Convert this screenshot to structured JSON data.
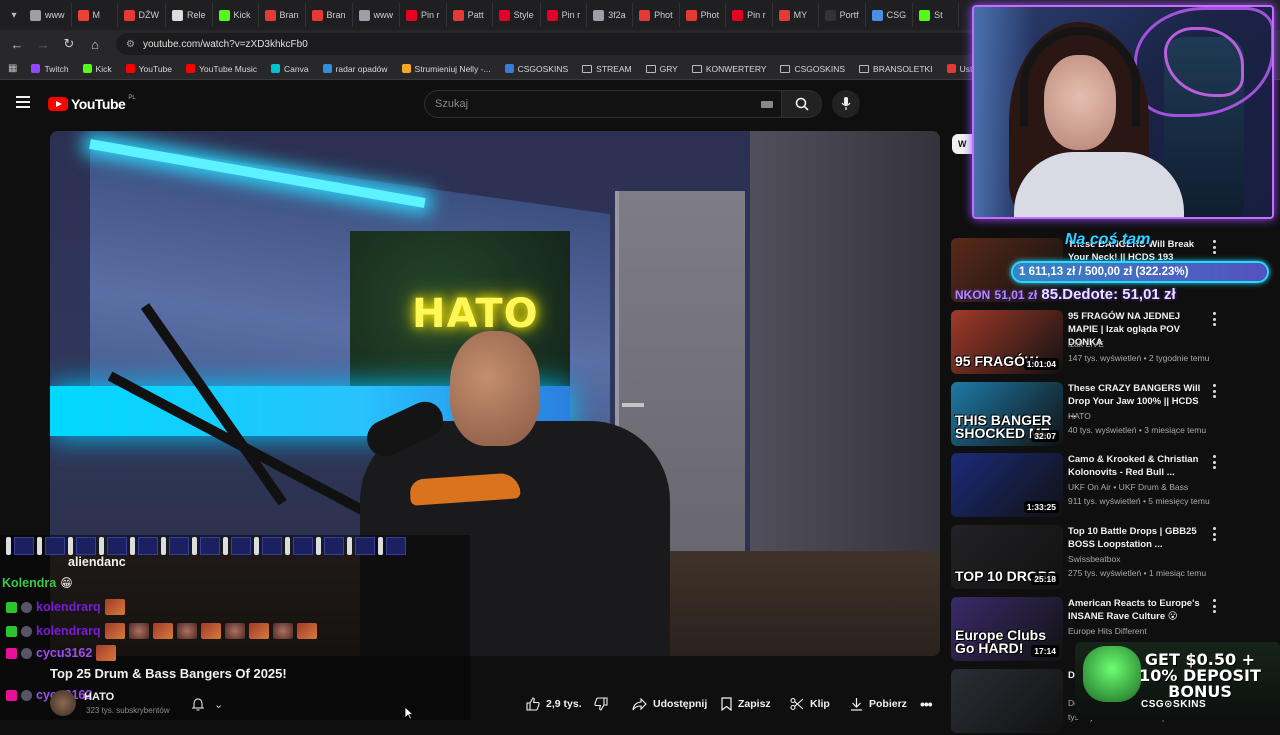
{
  "browser": {
    "tabs": [
      {
        "label": "www",
        "color": "#9aa0a6"
      },
      {
        "label": "M",
        "color": "#ea4335"
      },
      {
        "label": "DŹW",
        "color": "#e53935"
      },
      {
        "label": "Rele",
        "color": "#dddddd"
      },
      {
        "label": "Kick",
        "color": "#53fc18"
      },
      {
        "label": "Bran",
        "color": "#e53935"
      },
      {
        "label": "Bran",
        "color": "#e53935"
      },
      {
        "label": "www",
        "color": "#9aa0a6"
      },
      {
        "label": "Pin r",
        "color": "#e60023"
      },
      {
        "label": "Patt",
        "color": "#e53935"
      },
      {
        "label": "Style",
        "color": "#e60023"
      },
      {
        "label": "Pin r",
        "color": "#e60023"
      },
      {
        "label": "3f2a",
        "color": "#9aa0a6"
      },
      {
        "label": "Phot",
        "color": "#e53935"
      },
      {
        "label": "Phot",
        "color": "#e53935"
      },
      {
        "label": "Pin r",
        "color": "#e60023"
      },
      {
        "label": "MY",
        "color": "#e53935"
      },
      {
        "label": "Portf",
        "color": "#333333"
      },
      {
        "label": "CSG",
        "color": "#4a90e2"
      },
      {
        "label": "St",
        "color": "#53fc18"
      }
    ],
    "url": "youtube.com/watch?v=zXD3khkcFb0",
    "bookmarks": [
      {
        "label": "Twitch",
        "kind": "site",
        "color": "#9146ff"
      },
      {
        "label": "Kick",
        "kind": "site",
        "color": "#53fc18"
      },
      {
        "label": "YouTube",
        "kind": "site",
        "color": "#ff0000"
      },
      {
        "label": "YouTube Music",
        "kind": "site",
        "color": "#ff0000"
      },
      {
        "label": "Canva",
        "kind": "site",
        "color": "#00c4cc"
      },
      {
        "label": "radar opadów",
        "kind": "site",
        "color": "#2f8fd8"
      },
      {
        "label": "Strumieniuj Nelly -...",
        "kind": "site",
        "color": "#f5a623"
      },
      {
        "label": "CSGOSKINS",
        "kind": "site",
        "color": "#3a7bd5"
      },
      {
        "label": "STREAM",
        "kind": "folder"
      },
      {
        "label": "GRY",
        "kind": "folder"
      },
      {
        "label": "KONWERTERY",
        "kind": "folder"
      },
      {
        "label": "CSGOSKINS",
        "kind": "folder"
      },
      {
        "label": "BRANSOLETKI",
        "kind": "folder"
      },
      {
        "label": "Ustawienia strumien...",
        "kind": "site",
        "color": "#e53935"
      }
    ]
  },
  "youtube": {
    "logo": "YouTube",
    "region": "PL",
    "search_placeholder": "Szukaj",
    "chip_partial": "W"
  },
  "video": {
    "neon_sign": "HATO",
    "title": "Top 25 Drum & Bass Bangers Of 2025!",
    "channel": "HATO",
    "subscribers": "323 tys. subskrybentów",
    "likes": "2,9 tys.",
    "share_label": "Udostępnij",
    "save_label": "Zapisz",
    "clip_label": "Klip",
    "download_label": "Pobierz"
  },
  "chat": {
    "messages": [
      {
        "user": "aliendanc",
        "text": ""
      },
      {
        "user": "Kolendra",
        "text": ""
      },
      {
        "user": "kolendrarq",
        "text": ""
      },
      {
        "user": "kolendrarq",
        "text": ""
      },
      {
        "user": "cycu3162",
        "text": ""
      },
      {
        "user": "cycu3162",
        "text": ""
      }
    ]
  },
  "recommendations": [
    {
      "title": "These BANGERS Will Break Your Neck! || HCDS 193",
      "channel": "",
      "meta": "",
      "duration": "",
      "thumb": "#5a2a1a"
    },
    {
      "title": "95 FRAGÓW NA JEDNEJ MAPIE | Izak ogląda POV DONKA",
      "channel": "izak LIVE",
      "meta": "147 tys. wyświetleń • 2 tygodnie temu",
      "duration": "1:01:04",
      "thumb": "#a23a2a",
      "overlay": "95 FRAGÓW"
    },
    {
      "title": "These CRAZY BANGERS Will Drop Your Jaw 100% || HCDS ...",
      "channel": "HATO",
      "meta": "40 tys. wyświetleń • 3 miesiące temu",
      "duration": "32:07",
      "thumb": "#1e7aa8",
      "overlay": "THIS BANGER SHOCKED ME"
    },
    {
      "title": "Camo & Krooked & Christian Kolonovits - Red Bull ...",
      "channel": "UKF On Air • UKF Drum & Bass",
      "meta": "911 tys. wyświetleń • 5 miesięcy temu",
      "duration": "1:33:25",
      "thumb": "#1b2b7a"
    },
    {
      "title": "Top 10 Battle Drops | GBB25 BOSS Loopstation ...",
      "channel": "Swissbeatbox",
      "meta": "275 tys. wyświetleń • 1 miesiąc temu",
      "duration": "25:18",
      "thumb": "#222226",
      "overlay": "TOP 10 DROPS"
    },
    {
      "title": "American Reacts to Europe's INSANE Rave Culture 😮",
      "channel": "Europe Hits Different",
      "meta": "",
      "duration": "17:14",
      "thumb": "#3a2a6a",
      "overlay": "Europe Clubs Go HARD!"
    },
    {
      "title": "De...",
      "channel": "Dc",
      "meta": "tys. wyświetleń • 4 miesiące temu",
      "duration": "",
      "thumb": "#2a2f36"
    }
  ],
  "donation_goal": {
    "title": "Na coś tam",
    "current": "1 611,13 zł",
    "goal": "500,00 zł",
    "percent_text": "(322.23%)",
    "fill_fraction": 1.0,
    "last_donor_faded": "NKON",
    "last_donor_faded_amount": "51,01 zł",
    "last_donation": "85.Dedote: 51,01 zł"
  },
  "ad": {
    "headline": "GET $0.50 + 10% DEPOSIT BONUS",
    "brand": "CSG⊙SKINS"
  }
}
